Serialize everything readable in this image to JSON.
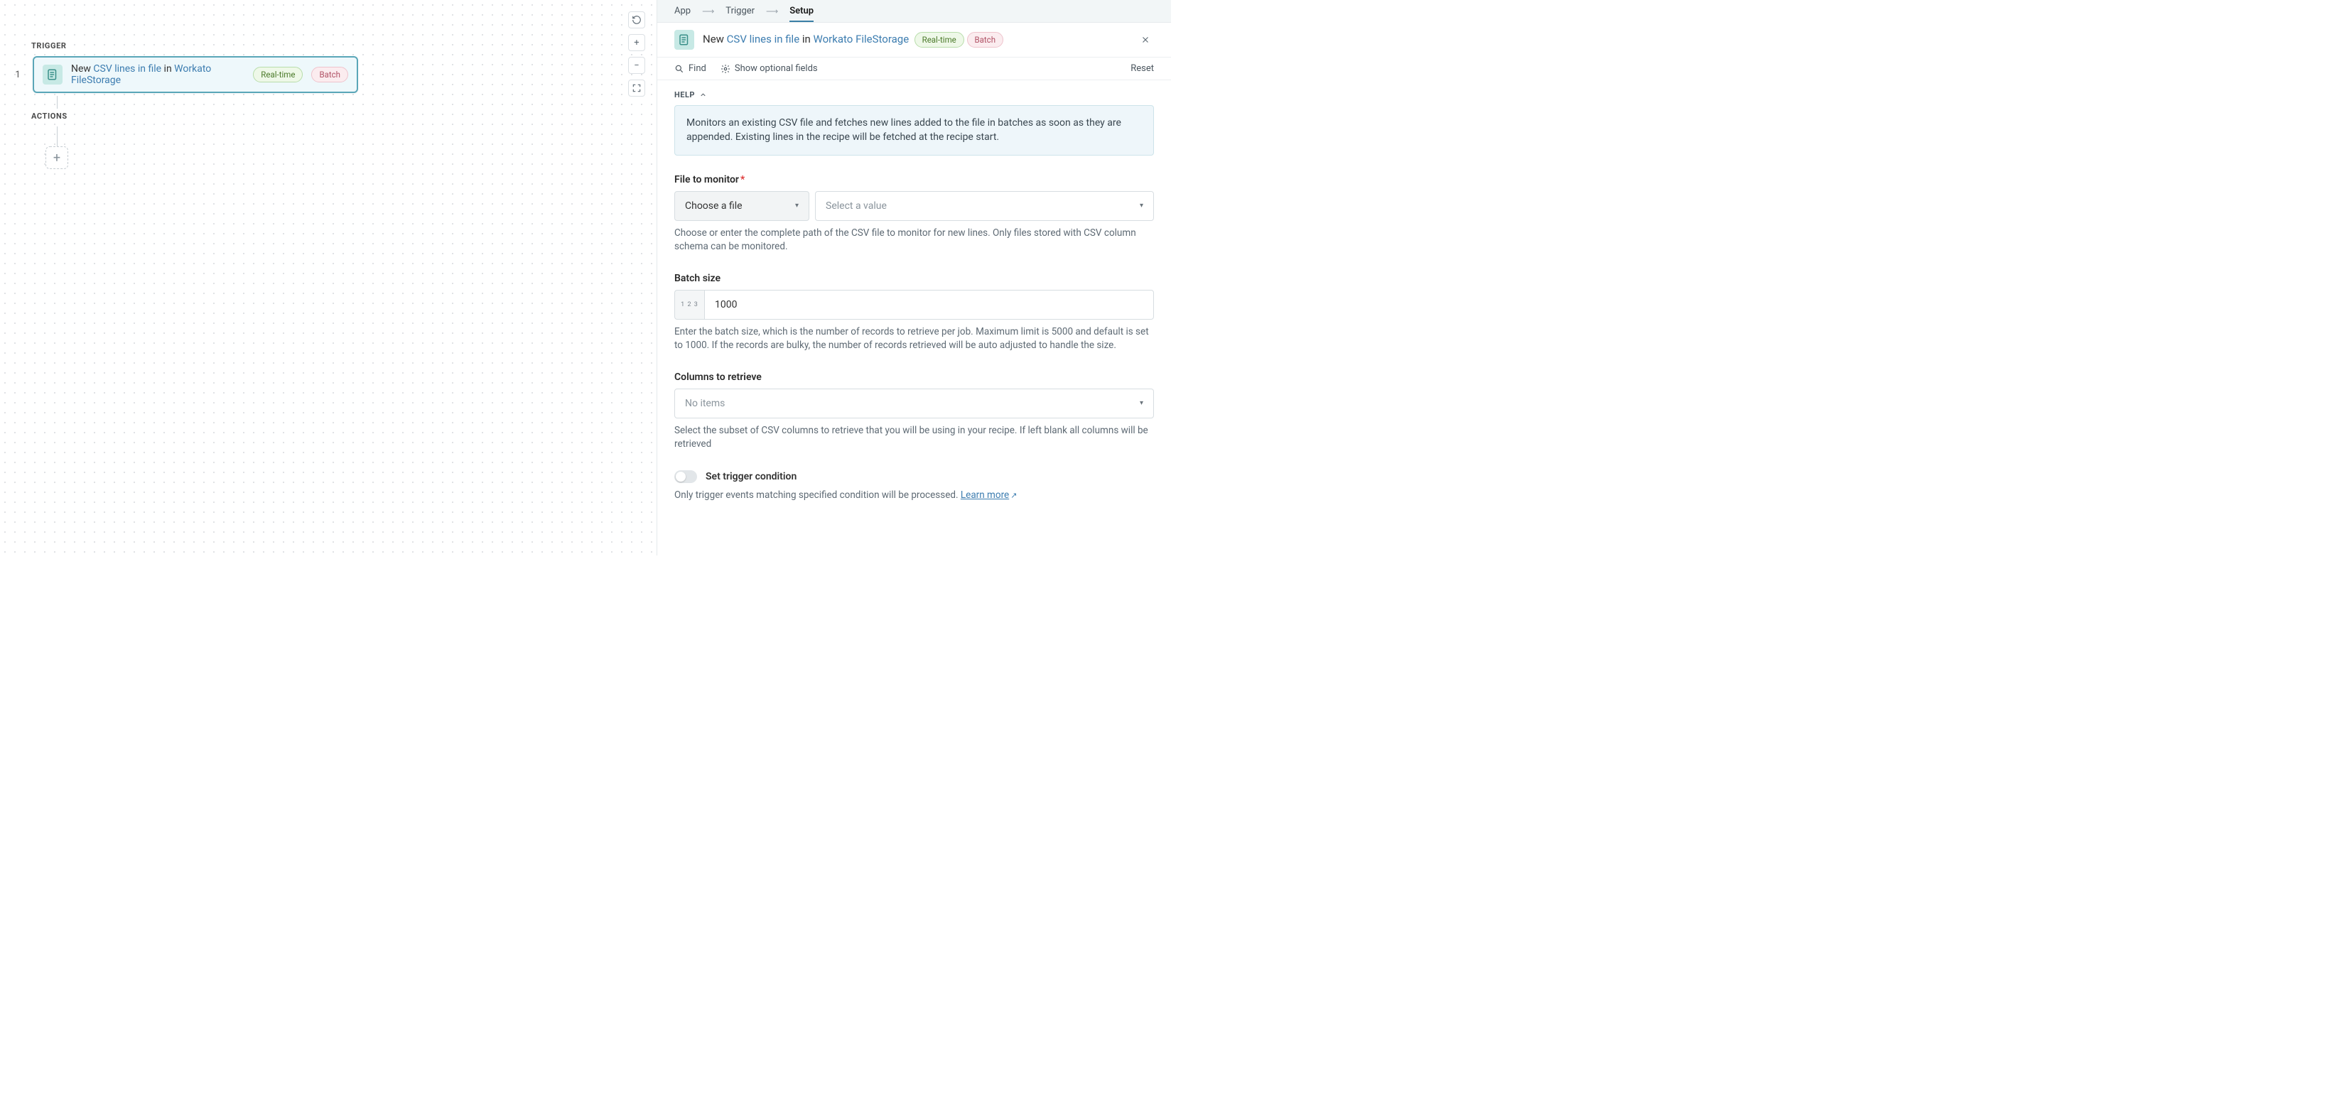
{
  "canvas": {
    "trigger_section_label": "TRIGGER",
    "actions_section_label": "ACTIONS",
    "step_number": "1",
    "step_text_prefix": "New ",
    "step_link1": "CSV lines in file",
    "step_text_mid": " in ",
    "step_link2": "Workato FileStorage",
    "badge_realtime": "Real-time",
    "badge_batch": "Batch",
    "add_step_symbol": "+"
  },
  "controls": {
    "undo": "↻",
    "zoom_in": "+",
    "zoom_out": "−",
    "fit": "⊹"
  },
  "panel": {
    "crumbs": {
      "app": "App",
      "trigger": "Trigger",
      "setup": "Setup"
    },
    "header": {
      "prefix": "New ",
      "link1": "CSV lines in file",
      "mid": " in ",
      "link2": "Workato FileStorage"
    },
    "toolbar": {
      "find": "Find",
      "show_optional": "Show optional fields",
      "reset": "Reset"
    },
    "help": {
      "label": "HELP",
      "body": "Monitors an existing CSV file and fetches new lines added to the file in batches as soon as they are appended. Existing lines in the recipe will be fetched at the recipe start."
    },
    "fields": {
      "file_to_monitor": {
        "label": "File to monitor",
        "choose_label": "Choose a file",
        "select_placeholder": "Select a value",
        "help": "Choose or enter the complete path of the CSV file to monitor for new lines. Only files stored with CSV column schema can be monitored."
      },
      "batch_size": {
        "label": "Batch size",
        "prefix": "1 2 3",
        "value": "1000",
        "help": "Enter the batch size, which is the number of records to retrieve per job. Maximum limit is 5000 and default is set to 1000. If the records are bulky, the number of records retrieved will be auto adjusted to handle the size."
      },
      "columns": {
        "label": "Columns to retrieve",
        "placeholder": "No items",
        "help": "Select the subset of CSV columns to retrieve that you will be using in your recipe. If left blank all columns will be retrieved"
      },
      "trigger_condition": {
        "label": "Set trigger condition",
        "help_prefix": "Only trigger events matching specified condition will be processed. ",
        "learn_more": "Learn more"
      }
    }
  }
}
